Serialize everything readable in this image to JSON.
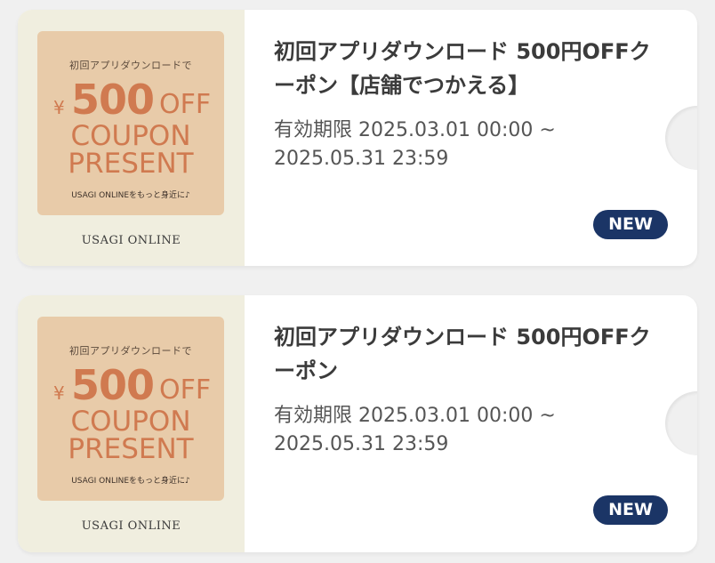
{
  "coupons": [
    {
      "thumbnail": {
        "top_text": "初回アプリダウンロードで",
        "yen": "¥",
        "amount": "500",
        "off": "OFF",
        "coupon": "COUPON",
        "present": "PRESENT",
        "footer": "USAGI ONLINEをもっと身近に♪"
      },
      "brand": "USAGI ONLINE",
      "title": "初回アプリダウンロード 500円OFFクーポン【店舗でつかえる】",
      "period": "有効期限 2025.03.01 00:00 ~ 2025.05.31 23:59",
      "badge": "NEW"
    },
    {
      "thumbnail": {
        "top_text": "初回アプリダウンロードで",
        "yen": "¥",
        "amount": "500",
        "off": "OFF",
        "coupon": "COUPON",
        "present": "PRESENT",
        "footer": "USAGI ONLINEをもっと身近に♪"
      },
      "brand": "USAGI ONLINE",
      "title": "初回アプリダウンロード 500円OFFクーポン",
      "period": "有効期限 2025.03.01 00:00 ~ 2025.05.31 23:59",
      "badge": "NEW"
    }
  ],
  "colors": {
    "badge_bg": "#1b3566",
    "thumb_bg": "#e8cba9",
    "thumb_text": "#d07a50",
    "left_panel_bg": "#f0eedf"
  }
}
